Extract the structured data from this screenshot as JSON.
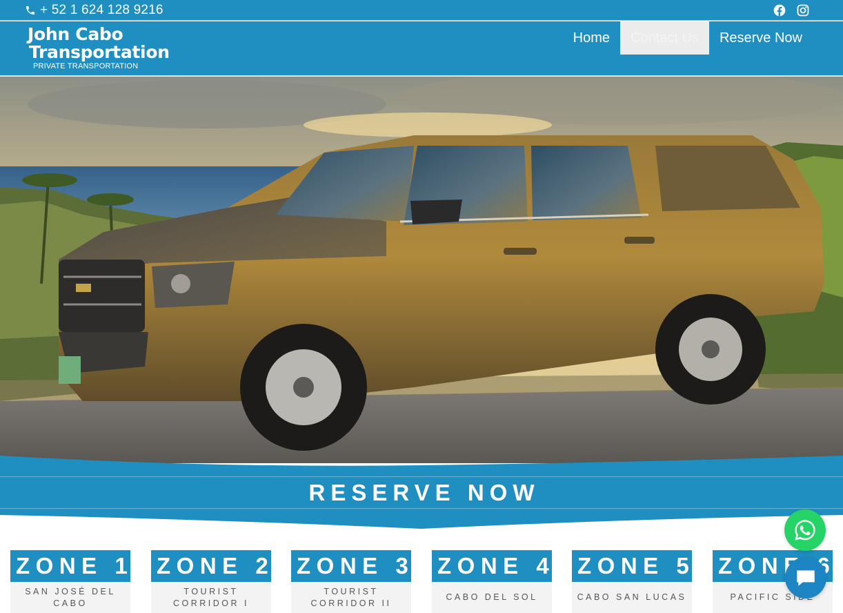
{
  "topbar": {
    "phone": "+ 52 1 624 128 9216",
    "phone_icon": "phone-icon",
    "social": [
      "facebook-icon",
      "instagram-icon"
    ]
  },
  "header": {
    "logo_line1": "John Cabo",
    "logo_line2": "Transportation",
    "logo_tagline": "PRIVATE TRANSPORTATION",
    "nav": [
      {
        "label": "Home"
      },
      {
        "label": "Contact Us",
        "active": true
      },
      {
        "label": "Reserve Now"
      }
    ]
  },
  "hero": {
    "image": "suv-on-coastal-road-at-sunset"
  },
  "reserve": {
    "title": "RESERVE NOW"
  },
  "zones": [
    {
      "title": "ZONE 1",
      "subtitle": "SAN JOSÉ DEL CABO"
    },
    {
      "title": "ZONE 2",
      "subtitle": "TOURIST CORRIDOR I"
    },
    {
      "title": "ZONE 3",
      "subtitle": "TOURIST CORRIDOR II"
    },
    {
      "title": "ZONE 4",
      "subtitle": "CABO DEL SOL"
    },
    {
      "title": "ZONE 5",
      "subtitle": "CABO SAN LUCAS"
    },
    {
      "title": "ZONE 6",
      "subtitle": "PACIFIC SIDE"
    }
  ],
  "floating": {
    "whatsapp_icon": "whatsapp-icon",
    "chat_icon": "chat-bubble-icon"
  },
  "colors": {
    "brand_blue": "#1e8fc0",
    "whatsapp_green": "#25d366",
    "chat_blue": "#1d85c4",
    "zone_body_bg": "#f3f3f3"
  }
}
